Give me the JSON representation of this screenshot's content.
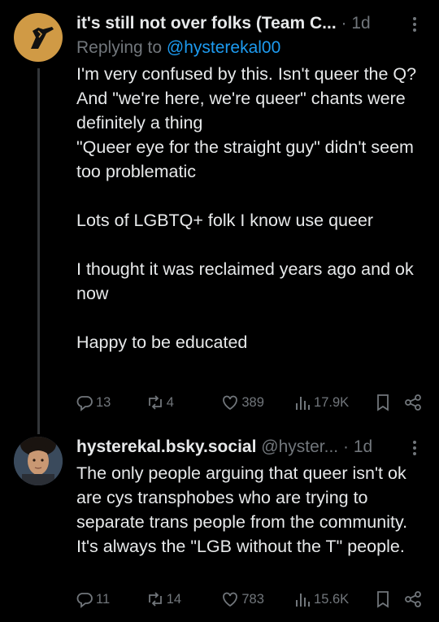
{
  "posts": [
    {
      "author_name": "it's still not over folks (Team C...",
      "handle": "",
      "dot": "·",
      "time": "1d",
      "reply_prefix": "Replying to ",
      "reply_to": "@hysterekal00",
      "text": "I'm very confused by this. Isn't queer the Q?\nAnd \"we're here, we're queer\" chants were definitely a thing\n\"Queer eye for the straight guy\" didn't seem too problematic\n\nLots of LGBTQ+ folk I know use queer\n\nI thought it was reclaimed years ago and ok now\n\nHappy to be educated",
      "replies": "13",
      "reposts": "4",
      "likes": "389",
      "views": "17.9K"
    },
    {
      "author_name": "hysterekal.bsky.social",
      "handle": "@hyster...",
      "dot": "·",
      "time": "1d",
      "text": "The only people arguing that queer isn't ok are cys transphobes who are trying to separate trans people from the community. It's always the \"LGB without the T\" people.",
      "replies": "11",
      "reposts": "14",
      "likes": "783",
      "views": "15.6K"
    }
  ],
  "colors": {
    "background": "#000000",
    "text": "#e7e9ea",
    "muted": "#71767b",
    "link": "#1d9bf0",
    "avatar1": "#d09a45"
  }
}
